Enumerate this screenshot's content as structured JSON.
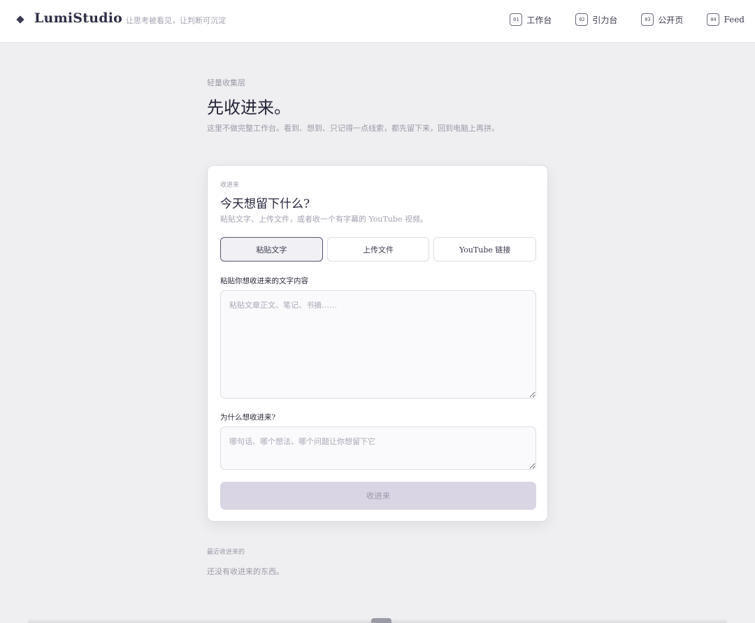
{
  "header": {
    "brand": "LumiStudio",
    "tagline": "让思考被看见，让判断可沉淀",
    "nav": [
      {
        "num": "01",
        "label": "工作台"
      },
      {
        "num": "02",
        "label": "引力台"
      },
      {
        "num": "03",
        "label": "公开页"
      },
      {
        "num": "04",
        "label": "Feed"
      }
    ]
  },
  "intro": {
    "eyebrow": "轻量收集层",
    "title": "先收进来。",
    "description": "这里不做完整工作台。看到、想到、只记得一点线索，都先留下来，回到电脑上再拼。"
  },
  "card": {
    "eyebrow": "收进来",
    "title": "今天想留下什么?",
    "subtitle": "粘贴文字、上传文件，或者收一个有字幕的 YouTube 视频。",
    "tabs": [
      {
        "label": "粘贴文字",
        "active": true
      },
      {
        "label": "上传文件",
        "active": false
      },
      {
        "label": "YouTube 链接",
        "active": false
      }
    ],
    "content_label": "粘贴你想收进来的文字内容",
    "content_value": "",
    "content_placeholder": "粘贴文章正文、笔记、书摘……",
    "why_label": "为什么想收进来?",
    "why_value": "",
    "why_placeholder": "哪句话、哪个想法、哪个问题让你想留下它",
    "submit_label": "收进来"
  },
  "recent": {
    "eyebrow": "最近收进来的",
    "empty_text": "还没有收进来的东西。"
  },
  "colors": {
    "accent": "#2e2e48",
    "submit_disabled": "#d9d5e4",
    "background": "#efeff1"
  }
}
